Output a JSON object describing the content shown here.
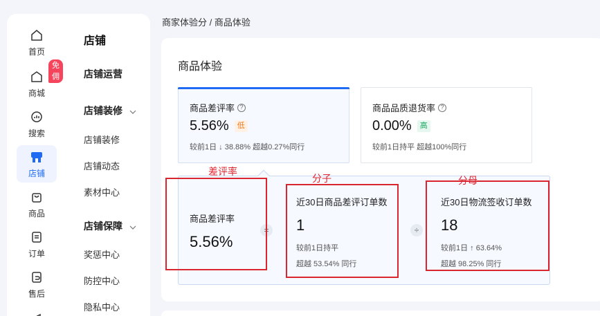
{
  "rail": {
    "items": [
      {
        "label": "首页",
        "icon": "home-icon"
      },
      {
        "label": "商城",
        "icon": "store-icon",
        "badge": "免佣"
      },
      {
        "label": "搜索",
        "icon": "search-icon"
      },
      {
        "label": "店铺",
        "icon": "shop-icon",
        "active": true
      },
      {
        "label": "商品",
        "icon": "bag-icon"
      },
      {
        "label": "订单",
        "icon": "order-icon"
      },
      {
        "label": "售后",
        "icon": "after-sale-icon"
      }
    ]
  },
  "submenu": {
    "title": "店铺",
    "sections": [
      {
        "label": "店铺运营"
      },
      {
        "label": "店铺装修",
        "items": [
          "店铺装修",
          "店铺动态",
          "素材中心"
        ]
      },
      {
        "label": "店铺保障",
        "items": [
          "奖惩中心",
          "防控中心",
          "隐私中心"
        ]
      }
    ]
  },
  "breadcrumb": "商家体验分 / 商品体验",
  "panel": {
    "title": "商品体验",
    "cards": [
      {
        "title": "商品差评率",
        "value": "5.56%",
        "tag": "低",
        "sub": "较前1日 ↓ 38.88%  超越0.27%同行"
      },
      {
        "title": "商品品质退货率",
        "value": "0.00%",
        "tag": "高",
        "sub": "较前1日持平  超越100%同行"
      }
    ],
    "formula": {
      "result": {
        "label": "商品差评率",
        "value": "5.56%"
      },
      "eq": "=",
      "numerator": {
        "label": "近30日商品差评订单数",
        "value": "1",
        "sub1": "较前1日持平",
        "sub2": "超越 53.54% 同行"
      },
      "div": "÷",
      "denominator": {
        "label": "近30日物流签收订单数",
        "value": "18",
        "sub1": "较前1日 ↑ 63.64%",
        "sub2": "超越 98.25% 同行"
      }
    }
  },
  "annotations": {
    "a1": "差评率",
    "a2": "分子",
    "a3": "分母"
  },
  "colors": {
    "accent": "#1f6bf3",
    "annotation": "#e0262f",
    "tag_low": "#f07a1a",
    "tag_high": "#19a862"
  }
}
